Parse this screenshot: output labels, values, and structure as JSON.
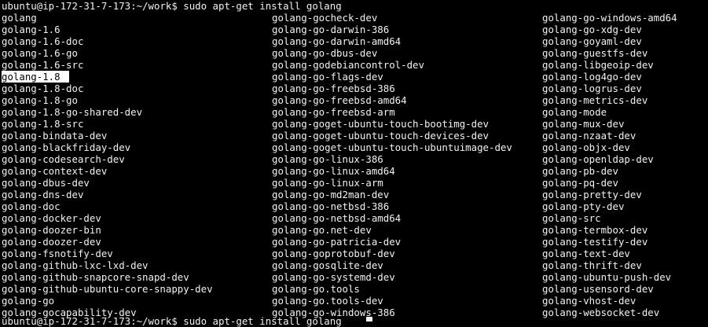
{
  "terminal": {
    "prompt": "ubuntu@ip-172-31-7-173:~/work$ sudo apt-get install golang",
    "partial_next_line": "ubuntu@ip-172-31-7-173:~/work$ sudo apt-get install golang",
    "colors": {
      "background": "#000000",
      "foreground": "#f2f2f2",
      "selection_bg": "#ffffff",
      "selection_fg": "#000000"
    },
    "selected_item": "golang-1.8",
    "columns": [
      [
        "golang",
        "golang-1.6",
        "golang-1.6-doc",
        "golang-1.6-go",
        "golang-1.6-src",
        "golang-1.8",
        "golang-1.8-doc",
        "golang-1.8-go",
        "golang-1.8-go-shared-dev",
        "golang-1.8-src",
        "golang-bindata-dev",
        "golang-blackfriday-dev",
        "golang-codesearch-dev",
        "golang-context-dev",
        "golang-dbus-dev",
        "golang-dns-dev",
        "golang-doc",
        "golang-docker-dev",
        "golang-doozer-bin",
        "golang-doozer-dev",
        "golang-fsnotify-dev",
        "golang-github-lxc-lxd-dev",
        "golang-github-snapcore-snapd-dev",
        "golang-github-ubuntu-core-snappy-dev",
        "golang-go",
        "golang-gocapability-dev"
      ],
      [
        "golang-gocheck-dev",
        "golang-go-darwin-386",
        "golang-go-darwin-amd64",
        "golang-go-dbus-dev",
        "golang-godebiancontrol-dev",
        "golang-go-flags-dev",
        "golang-go-freebsd-386",
        "golang-go-freebsd-amd64",
        "golang-go-freebsd-arm",
        "golang-goget-ubuntu-touch-bootimg-dev",
        "golang-goget-ubuntu-touch-devices-dev",
        "golang-goget-ubuntu-touch-ubuntuimage-dev",
        "golang-go-linux-386",
        "golang-go-linux-amd64",
        "golang-go-linux-arm",
        "golang-go-md2man-dev",
        "golang-go-netbsd-386",
        "golang-go-netbsd-amd64",
        "golang-go.net-dev",
        "golang-go-patricia-dev",
        "golang-goprotobuf-dev",
        "golang-gosqlite-dev",
        "golang-go-systemd-dev",
        "golang-go.tools",
        "golang-go.tools-dev",
        "golang-go-windows-386"
      ],
      [
        "golang-go-windows-amd64",
        "golang-go-xdg-dev",
        "golang-goyaml-dev",
        "golang-guestfs-dev",
        "golang-libgeoip-dev",
        "golang-log4go-dev",
        "golang-logrus-dev",
        "golang-metrics-dev",
        "golang-mode",
        "golang-mux-dev",
        "golang-nzaat-dev",
        "golang-objx-dev",
        "golang-openldap-dev",
        "golang-pb-dev",
        "golang-pq-dev",
        "golang-pretty-dev",
        "golang-pty-dev",
        "golang-src",
        "golang-termbox-dev",
        "golang-testify-dev",
        "golang-text-dev",
        "golang-thrift-dev",
        "golang-ubuntu-push-dev",
        "golang-usensord-dev",
        "golang-vhost-dev",
        "golang-websocket-dev"
      ]
    ]
  }
}
